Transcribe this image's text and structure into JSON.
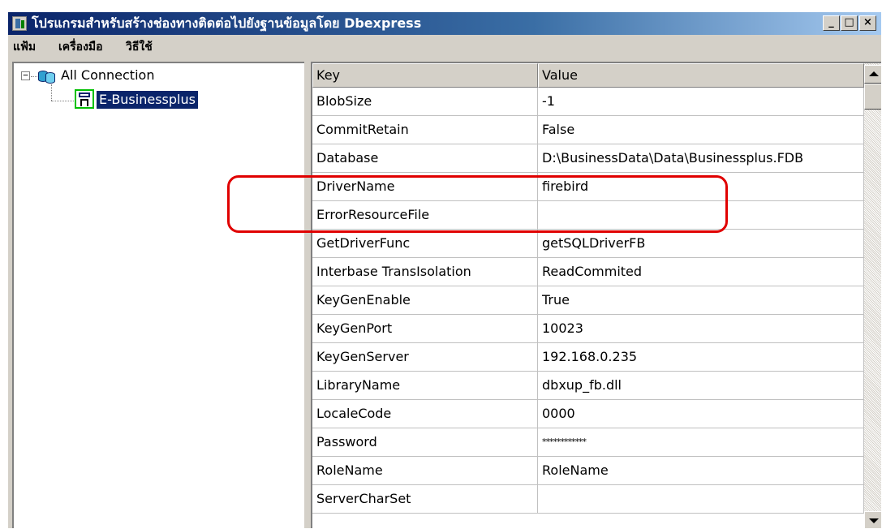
{
  "window": {
    "title": "โปรแกรมสำหรับสร้างช่องทางติดต่อไปยังฐานข้อมูลโดย Dbexpress",
    "min_label": "_",
    "max_label": "□",
    "close_label": "×"
  },
  "menu": {
    "items": [
      {
        "label": "แฟ้ม"
      },
      {
        "label": "เครื่องมือ"
      },
      {
        "label": "วิธีใช้"
      }
    ]
  },
  "tree": {
    "root_label": "All Connection",
    "expander": "−",
    "child_label": "E-Businessplus"
  },
  "grid": {
    "columns": {
      "key": "Key",
      "value": "Value"
    },
    "rows": [
      {
        "key": "BlobSize",
        "value": "-1"
      },
      {
        "key": "CommitRetain",
        "value": "False"
      },
      {
        "key": "Database",
        "value": "D:\\BusinessData\\Data\\Businessplus.FDB"
      },
      {
        "key": "DriverName",
        "value": "firebird"
      },
      {
        "key": "ErrorResourceFile",
        "value": ""
      },
      {
        "key": "GetDriverFunc",
        "value": "getSQLDriverFB"
      },
      {
        "key": "Interbase TransIsolation",
        "value": "ReadCommited"
      },
      {
        "key": "KeyGenEnable",
        "value": "True"
      },
      {
        "key": "KeyGenPort",
        "value": "10023"
      },
      {
        "key": "KeyGenServer",
        "value": "192.168.0.235"
      },
      {
        "key": "LibraryName",
        "value": "dbxup_fb.dll"
      },
      {
        "key": "LocaleCode",
        "value": "0000"
      },
      {
        "key": "Password",
        "value": "************"
      },
      {
        "key": "RoleName",
        "value": "RoleName"
      },
      {
        "key": "ServerCharSet",
        "value": ""
      }
    ]
  },
  "colors": {
    "titlebar": "#0a246a",
    "face": "#d4d0c8",
    "selection": "#0a246a",
    "highlight_annotation": "#e00000"
  }
}
